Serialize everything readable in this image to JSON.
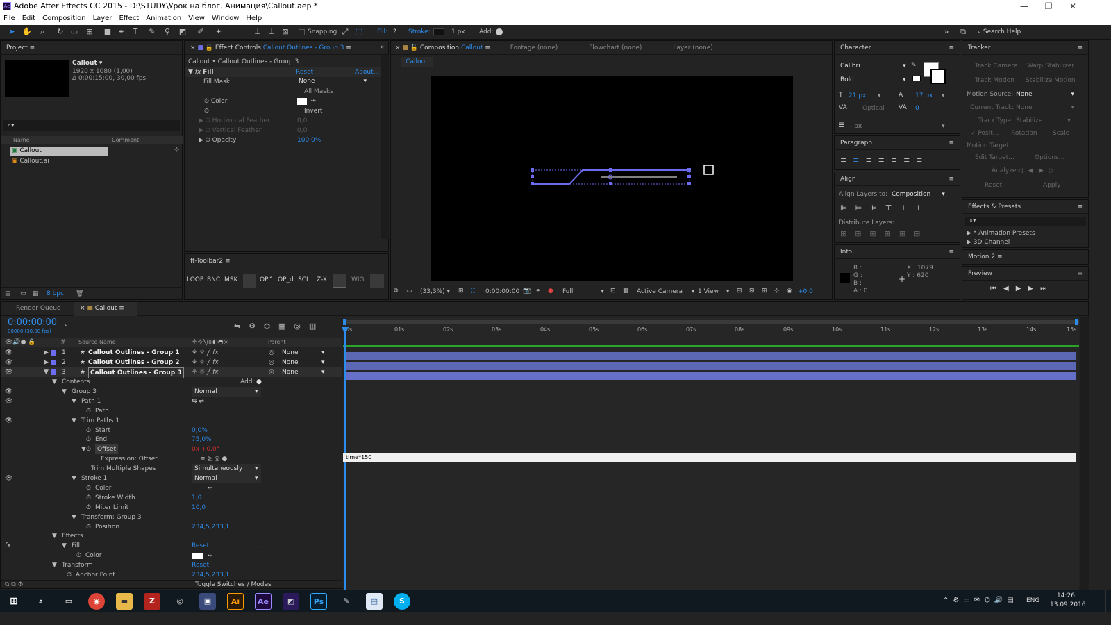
{
  "window": {
    "title": "Adobe After Effects CC 2015 - D:\\STUDY\\Урок на блог. Анимация\\Callout.aep *",
    "app_icon": "Ae"
  },
  "menu": [
    "File",
    "Edit",
    "Composition",
    "Layer",
    "Effect",
    "Animation",
    "View",
    "Window",
    "Help"
  ],
  "toolbar": {
    "snapping": "Snapping",
    "fill": "Fill:",
    "fill_val": "?",
    "stroke": "Stroke:",
    "stroke_px": "1 px",
    "add": "Add:",
    "search": "Search Help"
  },
  "project": {
    "title": "Project",
    "comp_name": "Callout ▾",
    "comp_res": "1920 x 1080 (1,00)",
    "comp_dur": "Δ 0:00:15:00, 30,00 fps",
    "col_name": "Name",
    "col_comment": "Comment",
    "items": [
      "Callout",
      "Callout.ai"
    ],
    "bpc": "8 bpc"
  },
  "effect_controls": {
    "title": "Effect Controls",
    "layer": "Callout Outlines - Group 3",
    "crumb": "Callout • Callout Outlines - Group 3",
    "fx_name": "Fill",
    "reset": "Reset",
    "about": "About...",
    "fill_mask": "Fill Mask",
    "fill_mask_val": "None",
    "all_masks": "All Masks",
    "color": "Color",
    "invert": "Invert",
    "h_feather": "Horizontal Feather",
    "h_feather_val": "0,0",
    "v_feather": "Vertical Feather",
    "v_feather_val": "0,0",
    "opacity": "Opacity",
    "opacity_val": "100,0%"
  },
  "ft_toolbar": {
    "title": "ft-Toolbar2",
    "buttons": [
      "LOOP",
      "BNC",
      "MSK",
      "",
      "OP^",
      "OP_d",
      "SCL",
      "Z-X",
      "",
      "WIG",
      ""
    ]
  },
  "composition": {
    "tab": "Composition",
    "tab_name": "Callout",
    "footage": "Footage (none)",
    "flowchart": "Flowchart (none)",
    "layer": "Layer (none)",
    "sub_tab": "Callout",
    "zoom": "(33,3%)",
    "time": "0:00:00:00",
    "res": "Full",
    "camera": "Active Camera",
    "view": "1 View",
    "exposure": "+0,0"
  },
  "character": {
    "title": "Character",
    "font": "Calibri",
    "style": "Bold",
    "size": "21 px",
    "leading": "17 px",
    "kerning": "Optical",
    "tracking": "0",
    "indent": "- px"
  },
  "paragraph": {
    "title": "Paragraph"
  },
  "align": {
    "title": "Align",
    "align_to_label": "Align Layers to:",
    "align_to": "Composition",
    "distribute": "Distribute Layers:"
  },
  "info": {
    "title": "Info",
    "r": "R :",
    "g": "G :",
    "b": "B :",
    "a": "A : 0",
    "x": "X : 1079",
    "y": "Y : 620"
  },
  "tracker": {
    "title": "Tracker",
    "track_camera": "Track Camera",
    "warp": "Warp Stabilizer",
    "track_motion": "Track Motion",
    "stabilize": "Stabilize Motion",
    "motion_source": "Motion Source:",
    "motion_source_val": "None",
    "current_track": "Current Track:",
    "current_track_val": "None",
    "track_type": "Track Type:",
    "track_type_val": "Stabilize",
    "position": "Posit...",
    "rotation": "Rotation",
    "scale": "Scale",
    "motion_target": "Motion Target:",
    "edit_target": "Edit Target...",
    "options": "Options...",
    "analyze": "Analyze:",
    "reset": "Reset",
    "apply": "Apply"
  },
  "effects_presets": {
    "title": "Effects & Presets",
    "items": [
      "* Animation Presets",
      "3D Channel"
    ]
  },
  "motion2": {
    "title": "Motion 2"
  },
  "preview": {
    "title": "Preview"
  },
  "timeline": {
    "tab_render": "Render Queue",
    "tab_comp": "Callout",
    "timecode": "0:00:00:00",
    "fps_line": "00000 (30.00 fps)",
    "col_source": "Source Name",
    "col_parent": "Parent",
    "hash": "#",
    "layers": [
      {
        "num": "1",
        "name": "Callout Outlines - Group 1",
        "parent": "None"
      },
      {
        "num": "2",
        "name": "Callout Outlines - Group 2",
        "parent": "None"
      },
      {
        "num": "3",
        "name": "Callout Outlines - Group 3",
        "parent": "None"
      }
    ],
    "props": [
      {
        "label": "Contents",
        "value": "",
        "extra": "Add:"
      },
      {
        "label": "Group 3",
        "value": "Normal"
      },
      {
        "label": "Path 1",
        "value": ""
      },
      {
        "label": "Path",
        "value": ""
      },
      {
        "label": "Trim Paths 1",
        "value": ""
      },
      {
        "label": "Start",
        "value": "0,0%"
      },
      {
        "label": "End",
        "value": "75,0%"
      },
      {
        "label": "Offset",
        "value": "0x +0,0°"
      },
      {
        "label": "Expression: Offset",
        "value": ""
      },
      {
        "label": "Trim Multiple Shapes",
        "value": "Simultaneously"
      },
      {
        "label": "Stroke 1",
        "value": "Normal"
      },
      {
        "label": "Color",
        "value": ""
      },
      {
        "label": "Stroke Width",
        "value": "1,0"
      },
      {
        "label": "Miter Limit",
        "value": "10,0"
      },
      {
        "label": "Transform: Group 3",
        "value": ""
      },
      {
        "label": "Position",
        "value": "234,5,233,1"
      },
      {
        "label": "Effects",
        "value": ""
      },
      {
        "label": "Fill",
        "value": "Reset"
      },
      {
        "label": "Color",
        "value": ""
      },
      {
        "label": "Transform",
        "value": "Reset"
      },
      {
        "label": "Anchor Point",
        "value": "234,5,233,1"
      }
    ],
    "expression": "time*150",
    "ruler": [
      "0s",
      "01s",
      "02s",
      "03s",
      "04s",
      "05s",
      "06s",
      "07s",
      "08s",
      "09s",
      "10s",
      "11s",
      "12s",
      "13s",
      "14s",
      "15s"
    ],
    "toggle": "Toggle Switches / Modes"
  },
  "taskbar": {
    "lang": "ENG",
    "time": "14:26",
    "date": "13.09.2016"
  },
  "colors": {
    "accent": "#2d8ceb",
    "layer_bar": "#5d68b5",
    "work_area": "#2aa32a",
    "path": "#6c6cf0",
    "offset_red": "#d03030"
  }
}
